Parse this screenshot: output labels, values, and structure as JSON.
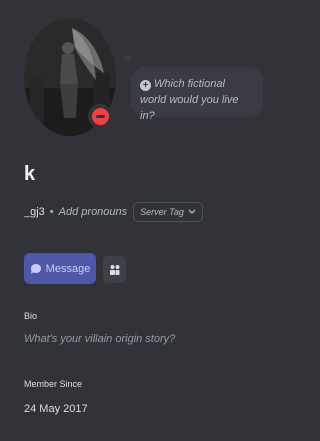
{
  "profile": {
    "display_name": "k",
    "username": "_gj3",
    "add_pronouns": "Add pronouns",
    "server_tag": "Server Tag",
    "status": "do-not-disturb",
    "status_color": "#f23f43"
  },
  "custom_status": {
    "prompt": "Which fictional world would you live in?",
    "icon": "add-circle-icon"
  },
  "actions": {
    "message_label": "Message",
    "message_icon": "chat-bubble-icon",
    "add_friend_icon": "add-friend-icon"
  },
  "bio": {
    "label": "Bio",
    "placeholder": "What's your villain origin story?"
  },
  "member_since": {
    "label": "Member Since",
    "date": "24 May 2017"
  },
  "colors": {
    "background": "#323339",
    "accent": "#4e57a8",
    "bubble": "#3b3c43"
  }
}
